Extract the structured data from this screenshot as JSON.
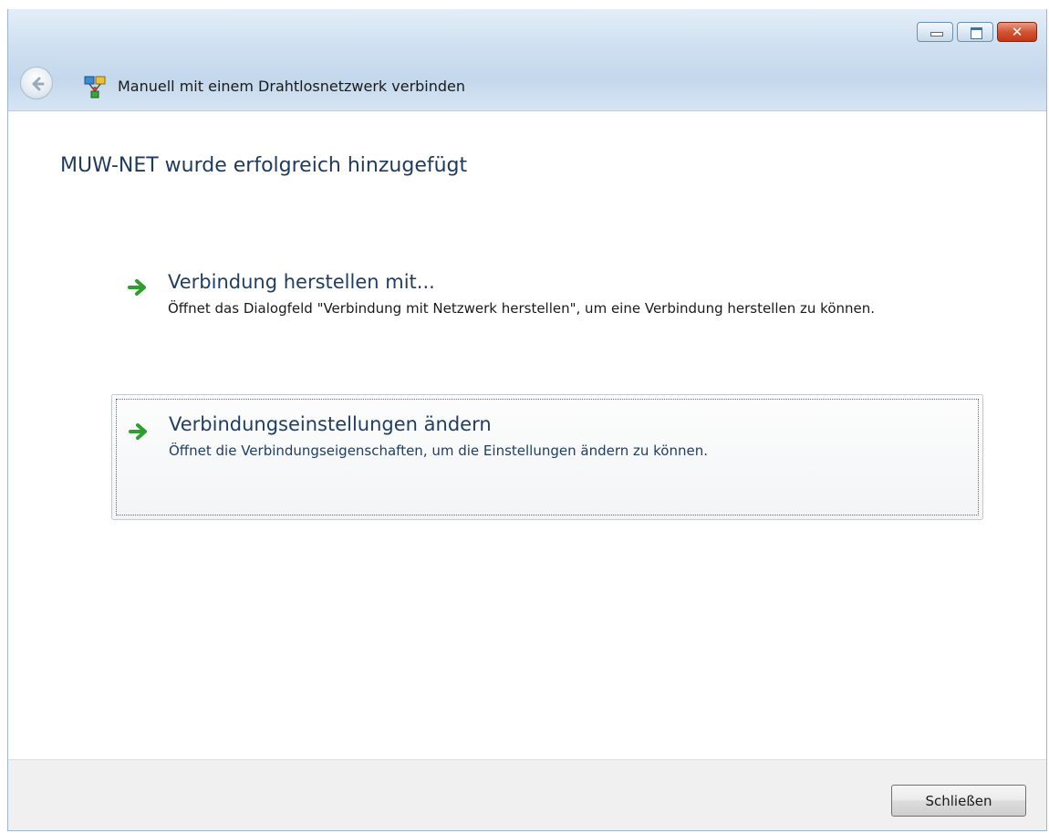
{
  "window": {
    "title": "Manuell mit einem Drahtlosnetzwerk verbinden",
    "icon": "wireless-network-icon",
    "controls": {
      "minimize": "minimize-icon",
      "maximize": "maximize-icon",
      "close": "close-icon"
    }
  },
  "main": {
    "heading": "MUW-NET wurde erfolgreich hinzugefügt",
    "options": [
      {
        "title": "Verbindung herstellen mit...",
        "description": "Öffnet das Dialogfeld \"Verbindung mit Netzwerk herstellen\", um eine Verbindung herstellen zu können.",
        "icon": "green-arrow-icon"
      },
      {
        "title": "Verbindungseinstellungen ändern",
        "description": "Öffnet die Verbindungseigenschaften, um die Einstellungen ändern zu können.",
        "icon": "green-arrow-icon"
      }
    ]
  },
  "footer": {
    "close_label": "Schließen"
  },
  "colors": {
    "heading": "#1e3a5f",
    "link": "#1f3e66",
    "arrow": "#2e9e2e",
    "close_button_red": "#c2361a"
  }
}
